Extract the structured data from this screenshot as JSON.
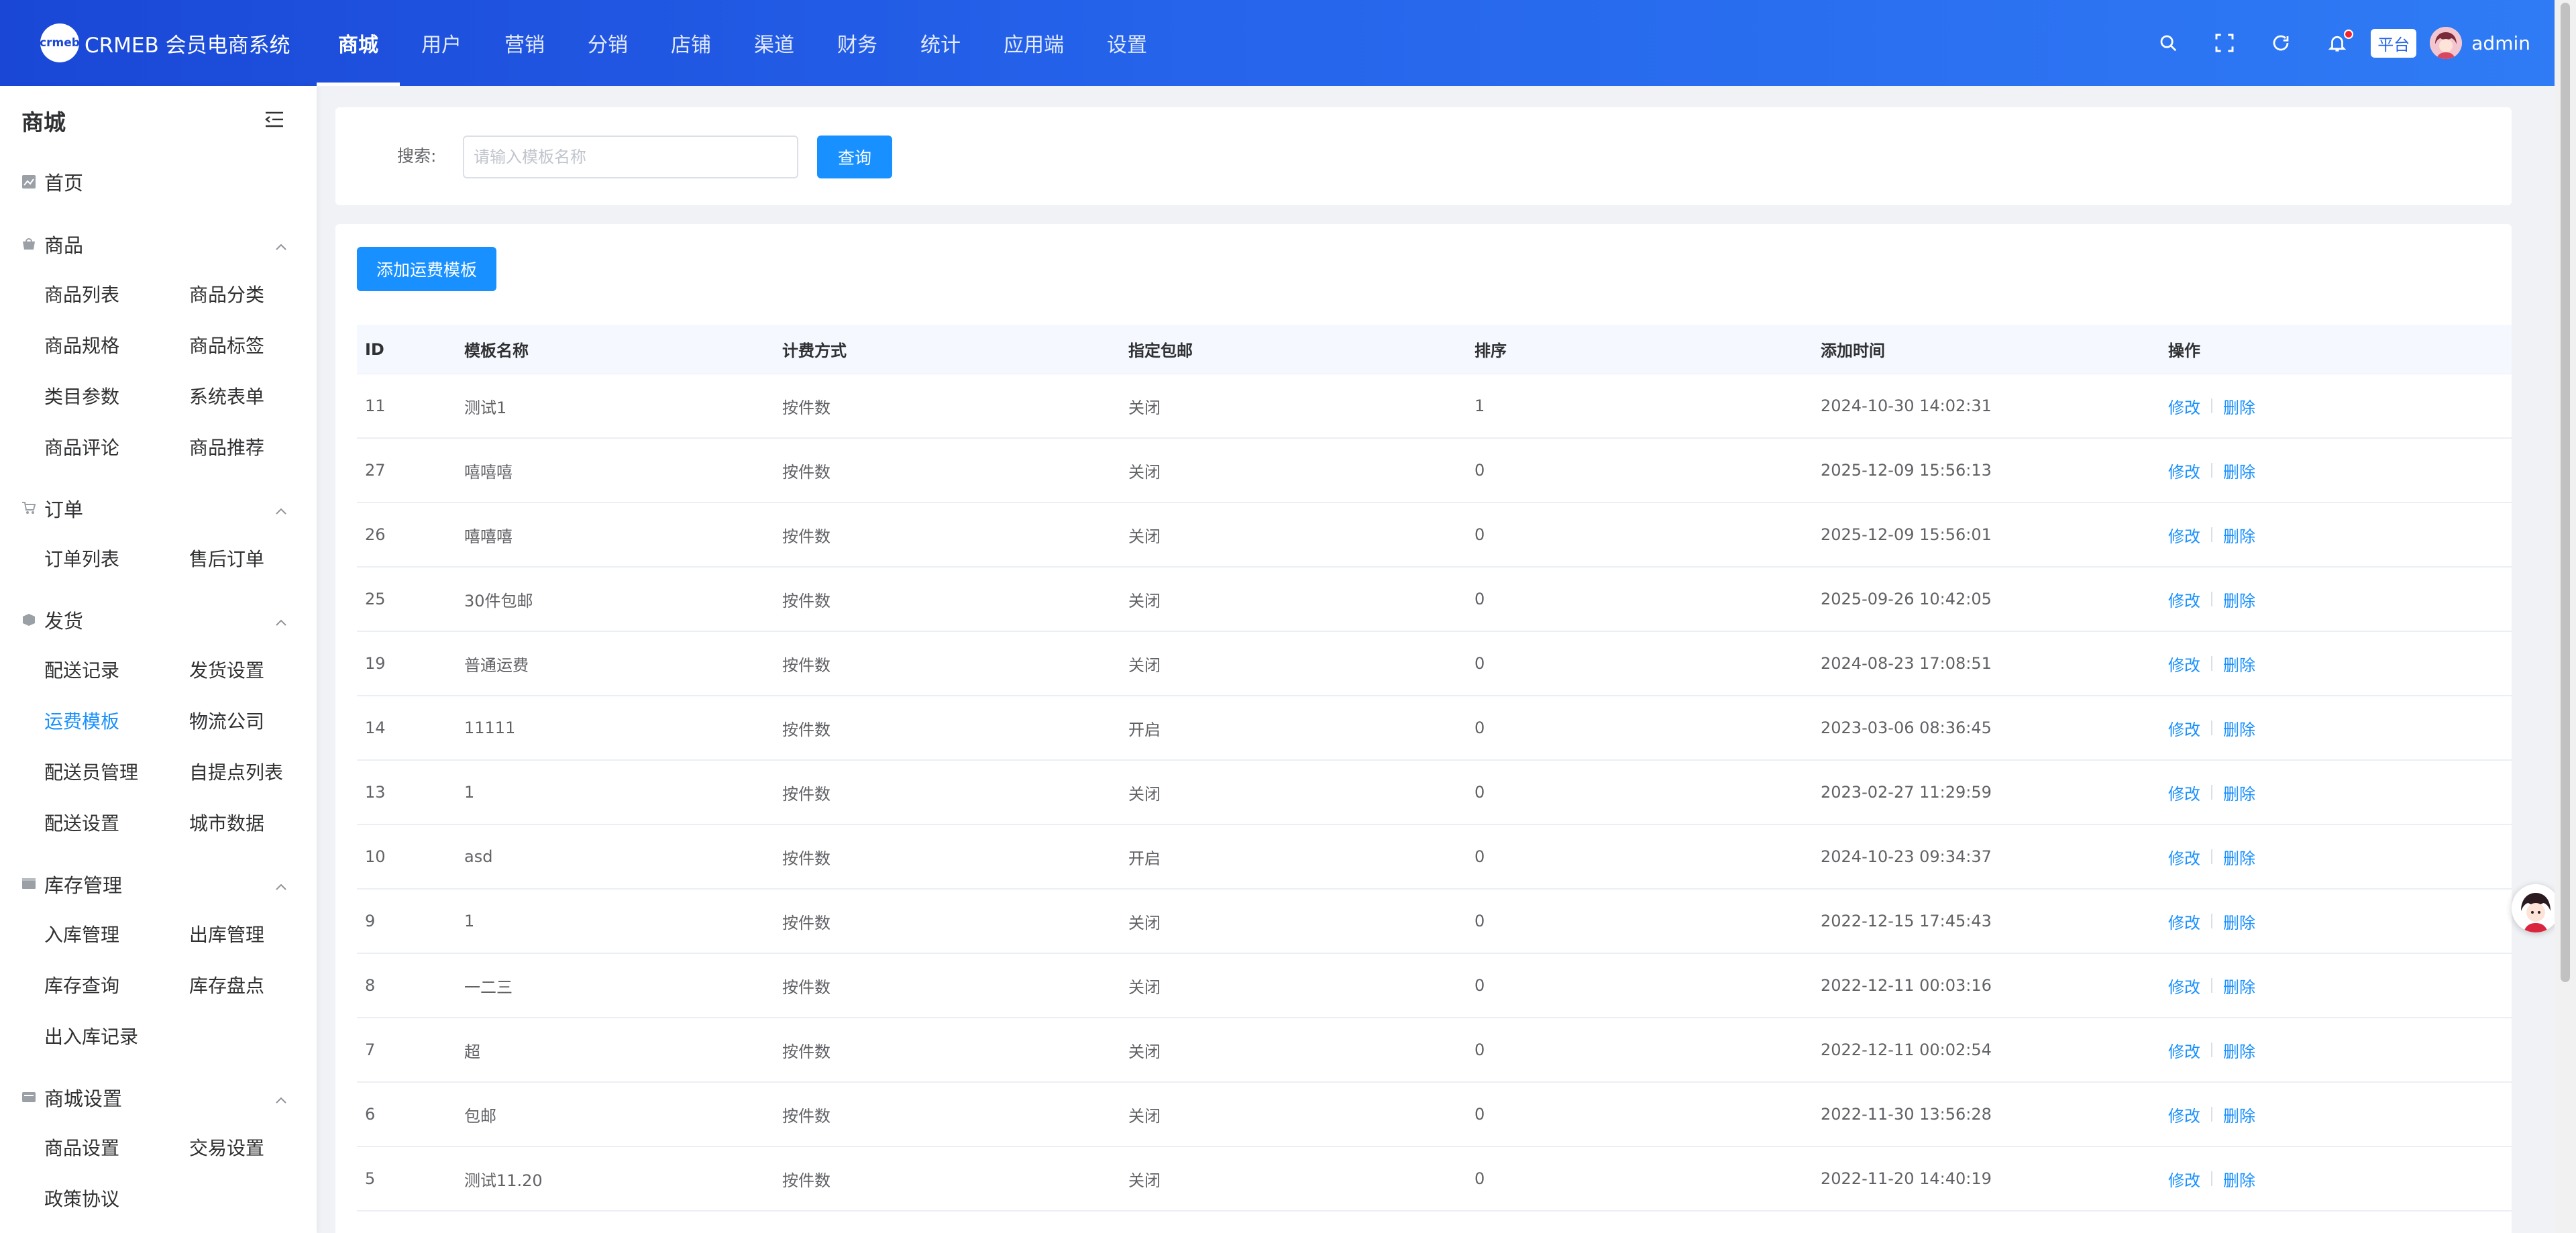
{
  "header": {
    "logo_mark": "crmeb",
    "app_title": "CRMEB 会员电商系统",
    "nav": [
      "商城",
      "用户",
      "营销",
      "分销",
      "店铺",
      "渠道",
      "财务",
      "统计",
      "应用端",
      "设置"
    ],
    "active_nav": "商城",
    "platform_label": "平台",
    "username": "admin",
    "accent": "#1a47d6"
  },
  "sidebar": {
    "title": "商城",
    "home": "首页",
    "groups": [
      {
        "title": "商品",
        "icon": "goods-icon",
        "items": [
          "商品列表",
          "商品分类",
          "商品规格",
          "商品标签",
          "类目参数",
          "系统表单",
          "商品评论",
          "商品推荐"
        ]
      },
      {
        "title": "订单",
        "icon": "cart-icon",
        "items": [
          "订单列表",
          "售后订单"
        ]
      },
      {
        "title": "发货",
        "icon": "truck-icon",
        "items": [
          "配送记录",
          "发货设置",
          "运费模板",
          "物流公司",
          "配送员管理",
          "自提点列表",
          "配送设置",
          "城市数据"
        ]
      },
      {
        "title": "库存管理",
        "icon": "stock-icon",
        "items": [
          "入库管理",
          "出库管理",
          "库存查询",
          "库存盘点",
          "出入库记录"
        ]
      },
      {
        "title": "商城设置",
        "icon": "settings-icon",
        "items": [
          "商品设置",
          "交易设置",
          "政策协议"
        ]
      }
    ],
    "active_item": "运费模板"
  },
  "search": {
    "label": "搜索:",
    "placeholder": "请输入模板名称",
    "value": "",
    "button": "查询"
  },
  "toolbar": {
    "add_label": "添加运费模板"
  },
  "table": {
    "columns": [
      "ID",
      "模板名称",
      "计费方式",
      "指定包邮",
      "排序",
      "添加时间",
      "操作"
    ],
    "edit_label": "修改",
    "delete_label": "删除",
    "rows": [
      {
        "id": "11",
        "name": "测试1",
        "way": "按件数",
        "free": "关闭",
        "sort": "1",
        "time": "2024-10-30 14:02:31"
      },
      {
        "id": "27",
        "name": "嘻嘻嘻",
        "way": "按件数",
        "free": "关闭",
        "sort": "0",
        "time": "2025-12-09 15:56:13"
      },
      {
        "id": "26",
        "name": "嘻嘻嘻",
        "way": "按件数",
        "free": "关闭",
        "sort": "0",
        "time": "2025-12-09 15:56:01"
      },
      {
        "id": "25",
        "name": "30件包邮",
        "way": "按件数",
        "free": "关闭",
        "sort": "0",
        "time": "2025-09-26 10:42:05"
      },
      {
        "id": "19",
        "name": "普通运费",
        "way": "按件数",
        "free": "关闭",
        "sort": "0",
        "time": "2024-08-23 17:08:51"
      },
      {
        "id": "14",
        "name": "11111",
        "way": "按件数",
        "free": "开启",
        "sort": "0",
        "time": "2023-03-06 08:36:45"
      },
      {
        "id": "13",
        "name": "1",
        "way": "按件数",
        "free": "关闭",
        "sort": "0",
        "time": "2023-02-27 11:29:59"
      },
      {
        "id": "10",
        "name": "asd",
        "way": "按件数",
        "free": "开启",
        "sort": "0",
        "time": "2024-10-23 09:34:37"
      },
      {
        "id": "9",
        "name": "1",
        "way": "按件数",
        "free": "关闭",
        "sort": "0",
        "time": "2022-12-15 17:45:43"
      },
      {
        "id": "8",
        "name": "一二三",
        "way": "按件数",
        "free": "关闭",
        "sort": "0",
        "time": "2022-12-11 00:03:16"
      },
      {
        "id": "7",
        "name": "超",
        "way": "按件数",
        "free": "关闭",
        "sort": "0",
        "time": "2022-12-11 00:02:54"
      },
      {
        "id": "6",
        "name": "包邮",
        "way": "按件数",
        "free": "关闭",
        "sort": "0",
        "time": "2022-11-30 13:56:28"
      },
      {
        "id": "5",
        "name": "测试11.20",
        "way": "按件数",
        "free": "关闭",
        "sort": "0",
        "time": "2022-11-20 14:40:19"
      }
    ]
  }
}
